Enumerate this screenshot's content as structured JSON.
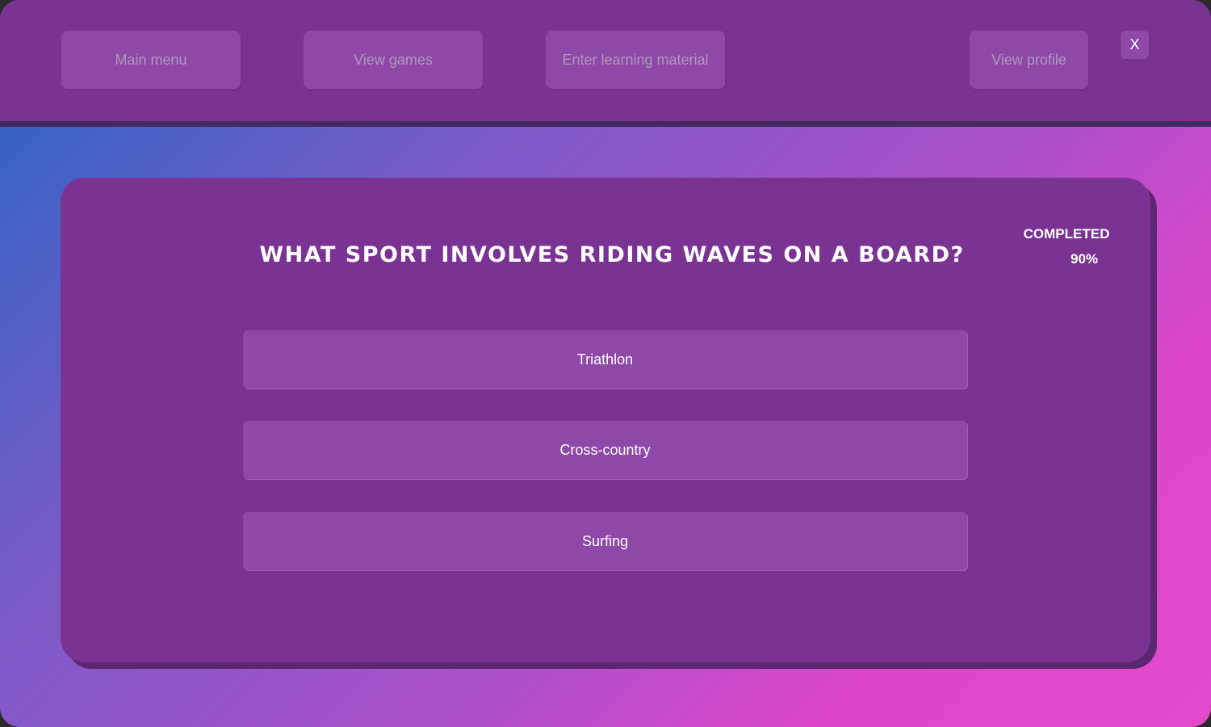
{
  "nav": {
    "main_menu": "Main menu",
    "view_games": "View games",
    "enter_learning_material": "Enter learning material",
    "view_profile": "View profile",
    "close": "X"
  },
  "quiz": {
    "question": "What sport involves riding waves on a board?",
    "answers": [
      "Triathlon",
      "Cross-country",
      "Surfing"
    ],
    "progress": {
      "label": "COMPLETED",
      "value": "90%"
    }
  },
  "colors": {
    "panel": "#7b3393",
    "button": "#8e48a8",
    "nav_text": "#b098bd",
    "gradient_start": "#2466c3",
    "gradient_end": "#e14acb"
  }
}
